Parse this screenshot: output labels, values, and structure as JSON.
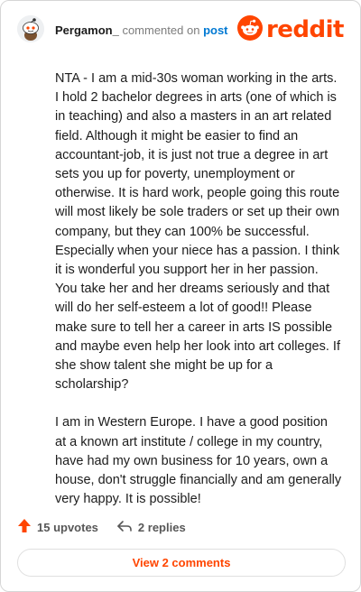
{
  "comment": {
    "username": "Pergamon_",
    "commented_text": "commented on",
    "post_link": "post",
    "paragraphs": [
      "NTA - I am a mid-30s woman working in the arts. I hold 2 bachelor degrees in arts (one of which is in teaching) and also a masters in an art related field. Although it might be easier to find an accountant-job, it is just not true a degree in art sets you up for poverty, unemployment or otherwise. It is hard work, people going this route will most likely be sole traders or set up their own company, but they can 100% be successful. Especially when your niece has a passion. I think it is wonderful you support her in her passion. You take her and her dreams seriously and that will do her self-esteem a lot of good!! Please make sure to tell her a career in arts IS possible and maybe even help her look into art colleges. If she show talent she might be up for a scholarship?",
      "I am in Western Europe. I have a good position at a known art institute / college in my country, have had my own business for 10 years, own a house, don't struggle financially and am generally very happy. It is possible!"
    ]
  },
  "brand": {
    "logo_text": "reddit",
    "color": "#ff4500"
  },
  "footer": {
    "upvotes": "15 upvotes",
    "replies": "2 replies",
    "view_comments": "View 2 comments"
  },
  "icons": {
    "avatar": "snoo-avatar-icon",
    "logo": "reddit-alien-icon",
    "upvote": "upvote-arrow-icon",
    "reply": "reply-arrow-icon"
  }
}
